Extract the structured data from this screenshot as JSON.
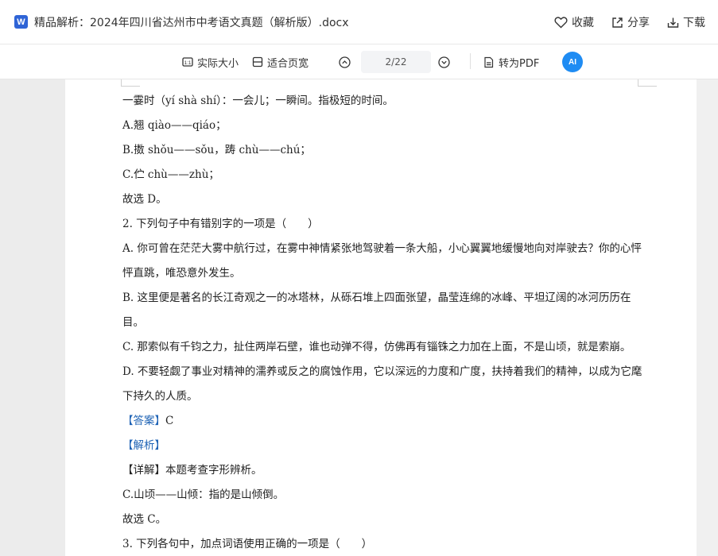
{
  "window": {
    "title": "精品解析：2024年四川省达州市中考语文真题（解析版）.docx",
    "actions": {
      "favorite": "收藏",
      "share": "分享",
      "download": "下载"
    }
  },
  "toolbar": {
    "actual_size": "实际大小",
    "fit_width": "适合页宽",
    "page_indicator": "2/22",
    "to_pdf": "转为PDF",
    "ai_label": "AI"
  },
  "document": {
    "lines": [
      "一霎时（yí shà shí）：一会儿；一瞬间。指极短的时间。",
      "A.翘 qiào——qiáo；",
      "B.擞 shǒu——sǒu，踌 chù——chú；",
      "C.伫 chù——zhù；",
      "故选 D。",
      "2. 下列句子中有错别字的一项是（　　）",
      "A. 你可曾在茫茫大雾中航行过，在雾中神情紧张地驾驶着一条大船，小心翼翼地缓慢地向对岸驶去？你的心怦怦直跳，唯恐意外发生。",
      "B. 这里便是著名的长江奇观之一的冰塔林，从砾石堆上四面张望，晶莹连绵的冰峰、平坦辽阔的冰河历历在目。",
      "C. 那索似有千钧之力，扯住两岸石壁，谁也动弹不得，仿佛再有锱铢之力加在上面，不是山顷，就是索崩。",
      "D. 不要轻觑了事业对精神的濡养或反之的腐蚀作用，它以深远的力度和广度，扶持着我们的精神，以成为它麾下持久的人质。"
    ],
    "answer_label": "【答案】",
    "answer_value": "C",
    "analysis_label": "【解析】",
    "detail_line": "【详解】本题考查字形辨析。",
    "correction_line": "C.山顷——山倾：指的是山倾倒。",
    "conclusion_line": "故选 C。",
    "next_question": "3. 下列各句中，加点词语使用正确的一项是（　　）"
  },
  "colors": {
    "accent": "#1f63b5",
    "ai_button": "#1f8cf3",
    "word_icon": "#2f64d6"
  }
}
